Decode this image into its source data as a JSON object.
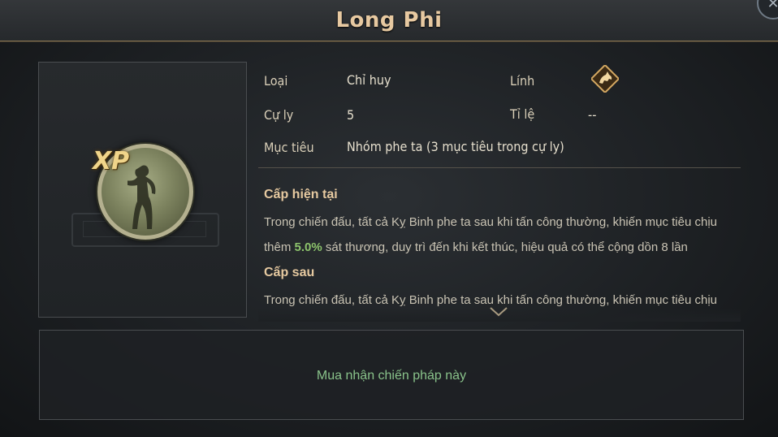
{
  "header": {
    "title": "Long Phi"
  },
  "skill": {
    "badge": "XP",
    "rows": {
      "type_label": "Loại",
      "type_value": "Chỉ huy",
      "soldier_label": "Lính",
      "range_label": "Cự ly",
      "range_value": "5",
      "rate_label": "Tỉ lệ",
      "rate_value": "--",
      "target_label": "Mục tiêu",
      "target_value": "Nhóm phe ta (3 mục tiêu trong cự ly)"
    },
    "current": {
      "heading": "Cấp hiện tại",
      "text_1": "Trong chiến đấu, tất cả Kỵ Binh phe ta sau khi tấn công thường, khiến mục tiêu chịu",
      "text_2a": "thêm ",
      "text_2b": "5.0%",
      "text_2c": " sát thương, duy trì đến khi kết thúc, hiệu quả có thể cộng dồn 8 lần"
    },
    "next": {
      "heading": "Cấp sau",
      "text_1": "Trong chiến đấu, tất cả Kỵ Binh phe ta sau khi tấn công thường, khiến mục tiêu chịu"
    }
  },
  "action": {
    "buy_label": "Mua nhận chiến pháp này"
  },
  "colors": {
    "title": "#e7c9a1",
    "highlight": "#8dc46c",
    "buy": "#89c28a",
    "border": "#8d7a55"
  },
  "icons": {
    "close": "close-icon",
    "soldier": "horse-icon",
    "scroll": "chevron-down-icon"
  }
}
